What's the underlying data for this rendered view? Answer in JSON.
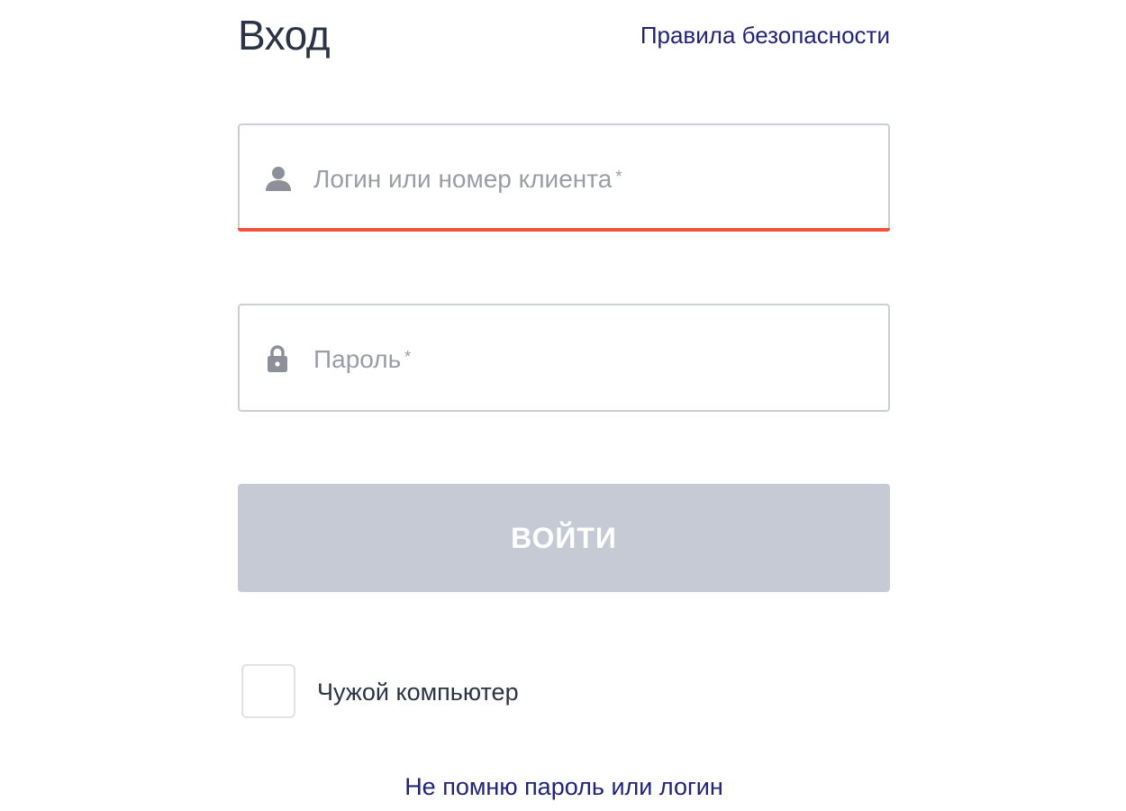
{
  "header": {
    "title": "Вход",
    "security_link": "Правила безопасности"
  },
  "form": {
    "login": {
      "placeholder": "Логин или номер клиента",
      "required_mark": "*",
      "icon": "user-icon",
      "error_underline_color": "#f0543c"
    },
    "password": {
      "placeholder": "Пароль",
      "required_mark": "*",
      "icon": "lock-icon"
    },
    "submit_label": "ВОЙТИ",
    "submit_color": "#c6cad4",
    "foreign_computer": {
      "label": "Чужой компьютер",
      "checked": false
    },
    "forgot_link": "Не помню пароль или логин"
  },
  "colors": {
    "accent": "#22237a",
    "text": "#2d3346",
    "placeholder": "#9a9da6"
  }
}
